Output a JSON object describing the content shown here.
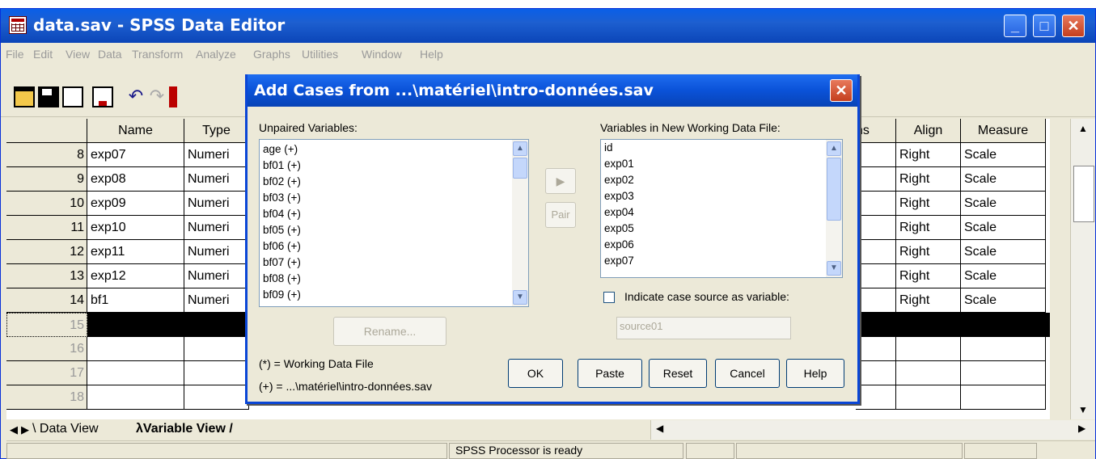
{
  "window": {
    "title": "data.sav - SPSS Data Editor",
    "buttons": {
      "minimize": "_",
      "maximize": "□",
      "close": "✕"
    }
  },
  "menu": [
    "File",
    "Edit",
    "View",
    "Data",
    "Transform",
    "Analyze",
    "Graphs",
    "Utilities",
    "Window",
    "Help"
  ],
  "grid": {
    "headers": {
      "name": "Name",
      "type": "Type",
      "columns_partial": "ns",
      "align": "Align",
      "measure": "Measure"
    },
    "rows": [
      {
        "num": "8",
        "name": "exp07",
        "type": "Numeri",
        "align": "Right",
        "measure": "Scale"
      },
      {
        "num": "9",
        "name": "exp08",
        "type": "Numeri",
        "align": "Right",
        "measure": "Scale"
      },
      {
        "num": "10",
        "name": "exp09",
        "type": "Numeri",
        "align": "Right",
        "measure": "Scale"
      },
      {
        "num": "11",
        "name": "exp10",
        "type": "Numeri",
        "align": "Right",
        "measure": "Scale"
      },
      {
        "num": "12",
        "name": "exp11",
        "type": "Numeri",
        "align": "Right",
        "measure": "Scale"
      },
      {
        "num": "13",
        "name": "exp12",
        "type": "Numeri",
        "align": "Right",
        "measure": "Scale"
      },
      {
        "num": "14",
        "name": "bf1",
        "type": "Numeri",
        "align": "Right",
        "measure": "Scale"
      }
    ],
    "empty_rows": [
      "15",
      "16",
      "17",
      "18"
    ]
  },
  "tabs": {
    "data_view": "Data View",
    "variable_view": "Variable View"
  },
  "status": {
    "message": "SPSS Processor  is ready"
  },
  "dialog": {
    "title": "Add Cases from ...\\matériel\\intro-données.sav",
    "unpaired_label": "Unpaired Variables:",
    "unpaired": [
      "age (+)",
      "bf01 (+)",
      "bf02 (+)",
      "bf03 (+)",
      "bf04 (+)",
      "bf05 (+)",
      "bf06 (+)",
      "bf07 (+)",
      "bf08 (+)",
      "bf09 (+)"
    ],
    "new_file_label": "Variables in New Working Data File:",
    "new_file": [
      "id",
      "exp01",
      "exp02",
      "exp03",
      "exp04",
      "exp05",
      "exp06",
      "exp07"
    ],
    "move_button": "▶",
    "pair_button": "Pair",
    "rename_button": "Rename...",
    "indicate_label": "Indicate case source as variable:",
    "source_value": "source01",
    "legend_working": "(*) = Working Data File",
    "legend_file": "(+) = ...\\matériel\\intro-données.sav",
    "ok": "OK",
    "paste": "Paste",
    "reset": "Reset",
    "cancel": "Cancel",
    "help": "Help"
  }
}
